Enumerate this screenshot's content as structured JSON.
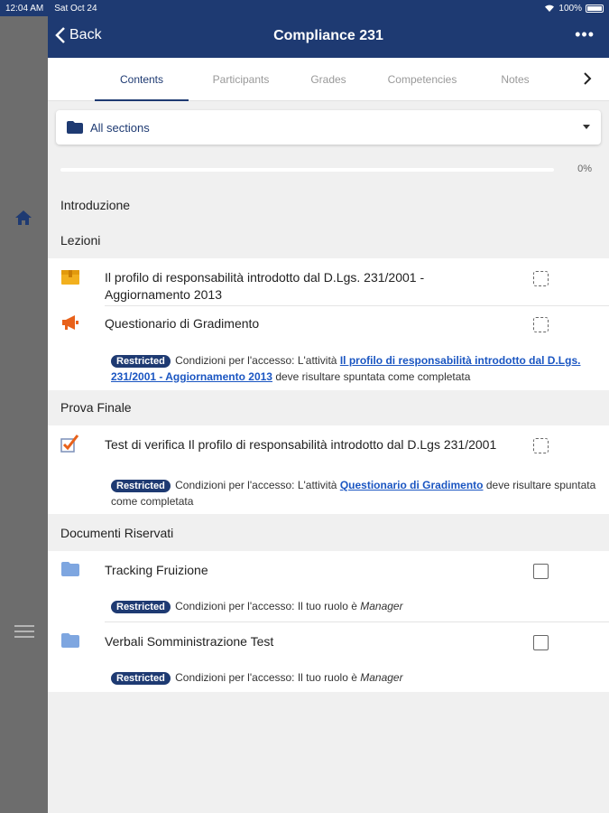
{
  "status_bar": {
    "time": "12:04 AM",
    "date": "Sat Oct 24",
    "battery": "100%"
  },
  "header": {
    "back_label": "Back",
    "title": "Compliance 231",
    "more_label": "•••"
  },
  "tabs": [
    {
      "label": "Contents",
      "active": true
    },
    {
      "label": "Participants",
      "active": false
    },
    {
      "label": "Grades",
      "active": false
    },
    {
      "label": "Competencies",
      "active": false
    },
    {
      "label": "Notes",
      "active": false
    }
  ],
  "section_selector": {
    "selected": "All sections"
  },
  "progress": {
    "value": 0,
    "label": "0%"
  },
  "sections": [
    {
      "title": "Introduzione"
    },
    {
      "title": "Lezioni",
      "items": [
        {
          "icon": "package-icon",
          "title": "Il profilo di responsabilità introdotto dal D.Lgs. 231/2001 - Aggiornamento 2013"
        },
        {
          "icon": "megaphone-icon",
          "title": "Questionario di Gradimento",
          "restriction": {
            "badge": "Restricted",
            "prefix": "Condizioni per l'accesso: L'attività ",
            "link": "Il profilo di responsabilità introdotto dal D.Lgs. 231/2001 - Aggiornamento 2013",
            "suffix": " deve risultare spuntata come completata"
          }
        }
      ]
    },
    {
      "title": "Prova Finale",
      "items": [
        {
          "icon": "quiz-checkmark-icon",
          "title": "Test di verifica Il profilo di responsabilità introdotto dal D.Lgs 231/2001",
          "restriction": {
            "badge": "Restricted",
            "prefix": "Condizioni per l'accesso: L'attività ",
            "link": "Questionario di Gradimento",
            "suffix": " deve risultare spuntata come completata"
          }
        }
      ]
    },
    {
      "title": "Documenti Riservati",
      "items": [
        {
          "icon": "folder-icon",
          "title": "Tracking Fruizione",
          "restriction": {
            "badge": "Restricted",
            "prefix": "Condizioni per l'accesso: Il tuo ruolo è ",
            "role": "Manager"
          }
        },
        {
          "icon": "folder-icon",
          "title": "Verbali Somministrazione Test",
          "restriction": {
            "badge": "Restricted",
            "prefix": "Condizioni per l'accesso: Il tuo ruolo è ",
            "role": "Manager"
          }
        }
      ]
    }
  ],
  "colors": {
    "primary": "#1e3a72",
    "link": "#1b56c2",
    "sidebar": "#6d6d6d",
    "package": "#f2b01e",
    "megaphone": "#e8611a"
  }
}
